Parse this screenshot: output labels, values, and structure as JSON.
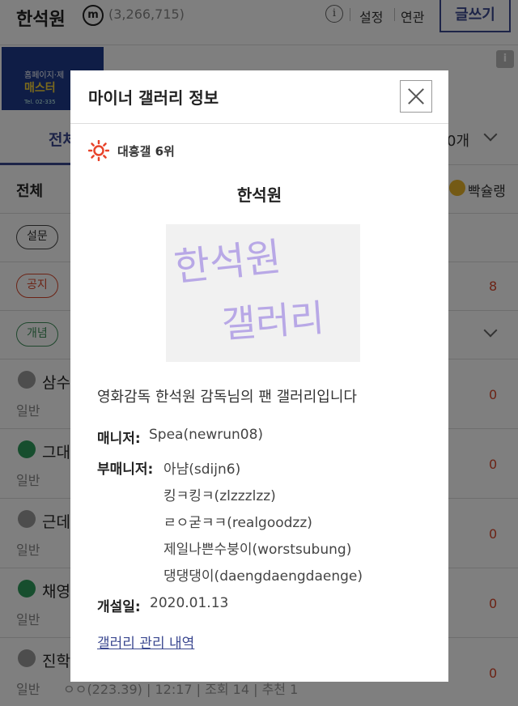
{
  "header": {
    "gallery_name": "한석원",
    "minor_badge": "m",
    "visitor_count": "(3,266,715)",
    "info_icon": "i",
    "links": [
      "설정",
      "연관"
    ],
    "write_button": "글쓰기"
  },
  "banner": {
    "line1": "홈페이지·제",
    "line2": "매스터",
    "line3": "Tel. 02-335"
  },
  "ad_badge": "i",
  "tabs": {
    "active": "전체",
    "count_fragment": "0개"
  },
  "subtabs": {
    "left": "전체",
    "right": "빡슐랭"
  },
  "pill_rows": [
    {
      "label": "설문",
      "style": "plain",
      "right": ""
    },
    {
      "label": "공지",
      "style": "red",
      "right": "8"
    },
    {
      "label": "개념",
      "style": "green",
      "right": ""
    }
  ],
  "posts": [
    {
      "title": "삼수",
      "category": "일반",
      "icon": "gray",
      "count": "0"
    },
    {
      "title": "그대",
      "category": "일반",
      "icon": "green",
      "count": "0"
    },
    {
      "title": "근데",
      "category": "일반",
      "icon": "gray",
      "count": "0"
    },
    {
      "title": "채영",
      "category": "일반",
      "icon": "green",
      "count": "0"
    },
    {
      "title": "진학",
      "category": "일반",
      "icon": "gray",
      "count": "0"
    }
  ],
  "last_post_meta": "ㅇㅇ(223.39) | 12:17 | 조회 14 | 추천 1",
  "modal": {
    "title": "마이너 갤러리 정보",
    "rank": "대흥갤 6위",
    "name": "한석원",
    "image_text": [
      "한석원",
      "갤러리"
    ],
    "description": "영화감독 한석원 감독님의 팬 갤러리입니다",
    "manager_label": "매니저:",
    "manager": "Spea(newrun08)",
    "submanager_label": "부매니저:",
    "submanagers": [
      "아냠(sdijn6)",
      "킹ㅋ킹ㅋ(zlzzzlzz)",
      "ㄹㅇ굳ㅋㅋ(realgoodzz)",
      "제일나쁜수붕이(worstsubung)",
      "댕댕댕이(daengdaengdaenge)"
    ],
    "opened_label": "개설일:",
    "opened": "2020.01.13",
    "history_link": "갤러리 관리 내역"
  },
  "colors": {
    "accent": "#3b4890",
    "alert": "#d9472b",
    "rank_sun": "#e8432a"
  }
}
